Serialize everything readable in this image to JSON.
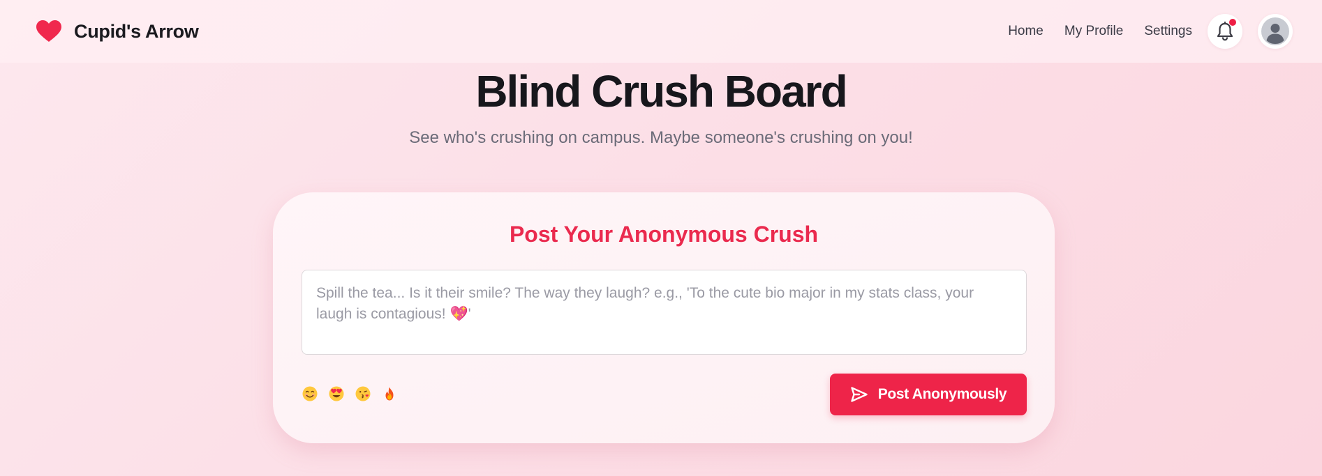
{
  "header": {
    "brand_name": "Cupid's Arrow",
    "brand_icon": "heart-icon",
    "nav": [
      {
        "label": "Home"
      },
      {
        "label": "My Profile"
      },
      {
        "label": "Settings"
      }
    ],
    "notification_icon": "bell-icon",
    "has_unread_notifications": true,
    "avatar_icon": "user-avatar-icon"
  },
  "hero": {
    "title": "Blind Crush Board",
    "subtitle": "See who's crushing on campus. Maybe someone's crushing on you!"
  },
  "post_card": {
    "title": "Post Your Anonymous Crush",
    "input_placeholder": "Spill the tea... Is it their smile? The way they laugh? e.g., 'To the cute bio major in my stats class, your laugh is contagious! 💖'",
    "input_value": "",
    "emojis": [
      {
        "name": "smiling-face-emoji",
        "char": "😊"
      },
      {
        "name": "heart-eyes-emoji",
        "char": "😍"
      },
      {
        "name": "kissing-face-emoji",
        "char": "😘"
      },
      {
        "name": "fire-emoji",
        "char": "🔥"
      }
    ],
    "submit_label": "Post Anonymously",
    "submit_icon": "send-icon"
  },
  "colors": {
    "accent": "#ee2449",
    "title_accent": "#ea2a4e",
    "notification_dot": "#ee1f45",
    "background": "#fcdfe7"
  }
}
